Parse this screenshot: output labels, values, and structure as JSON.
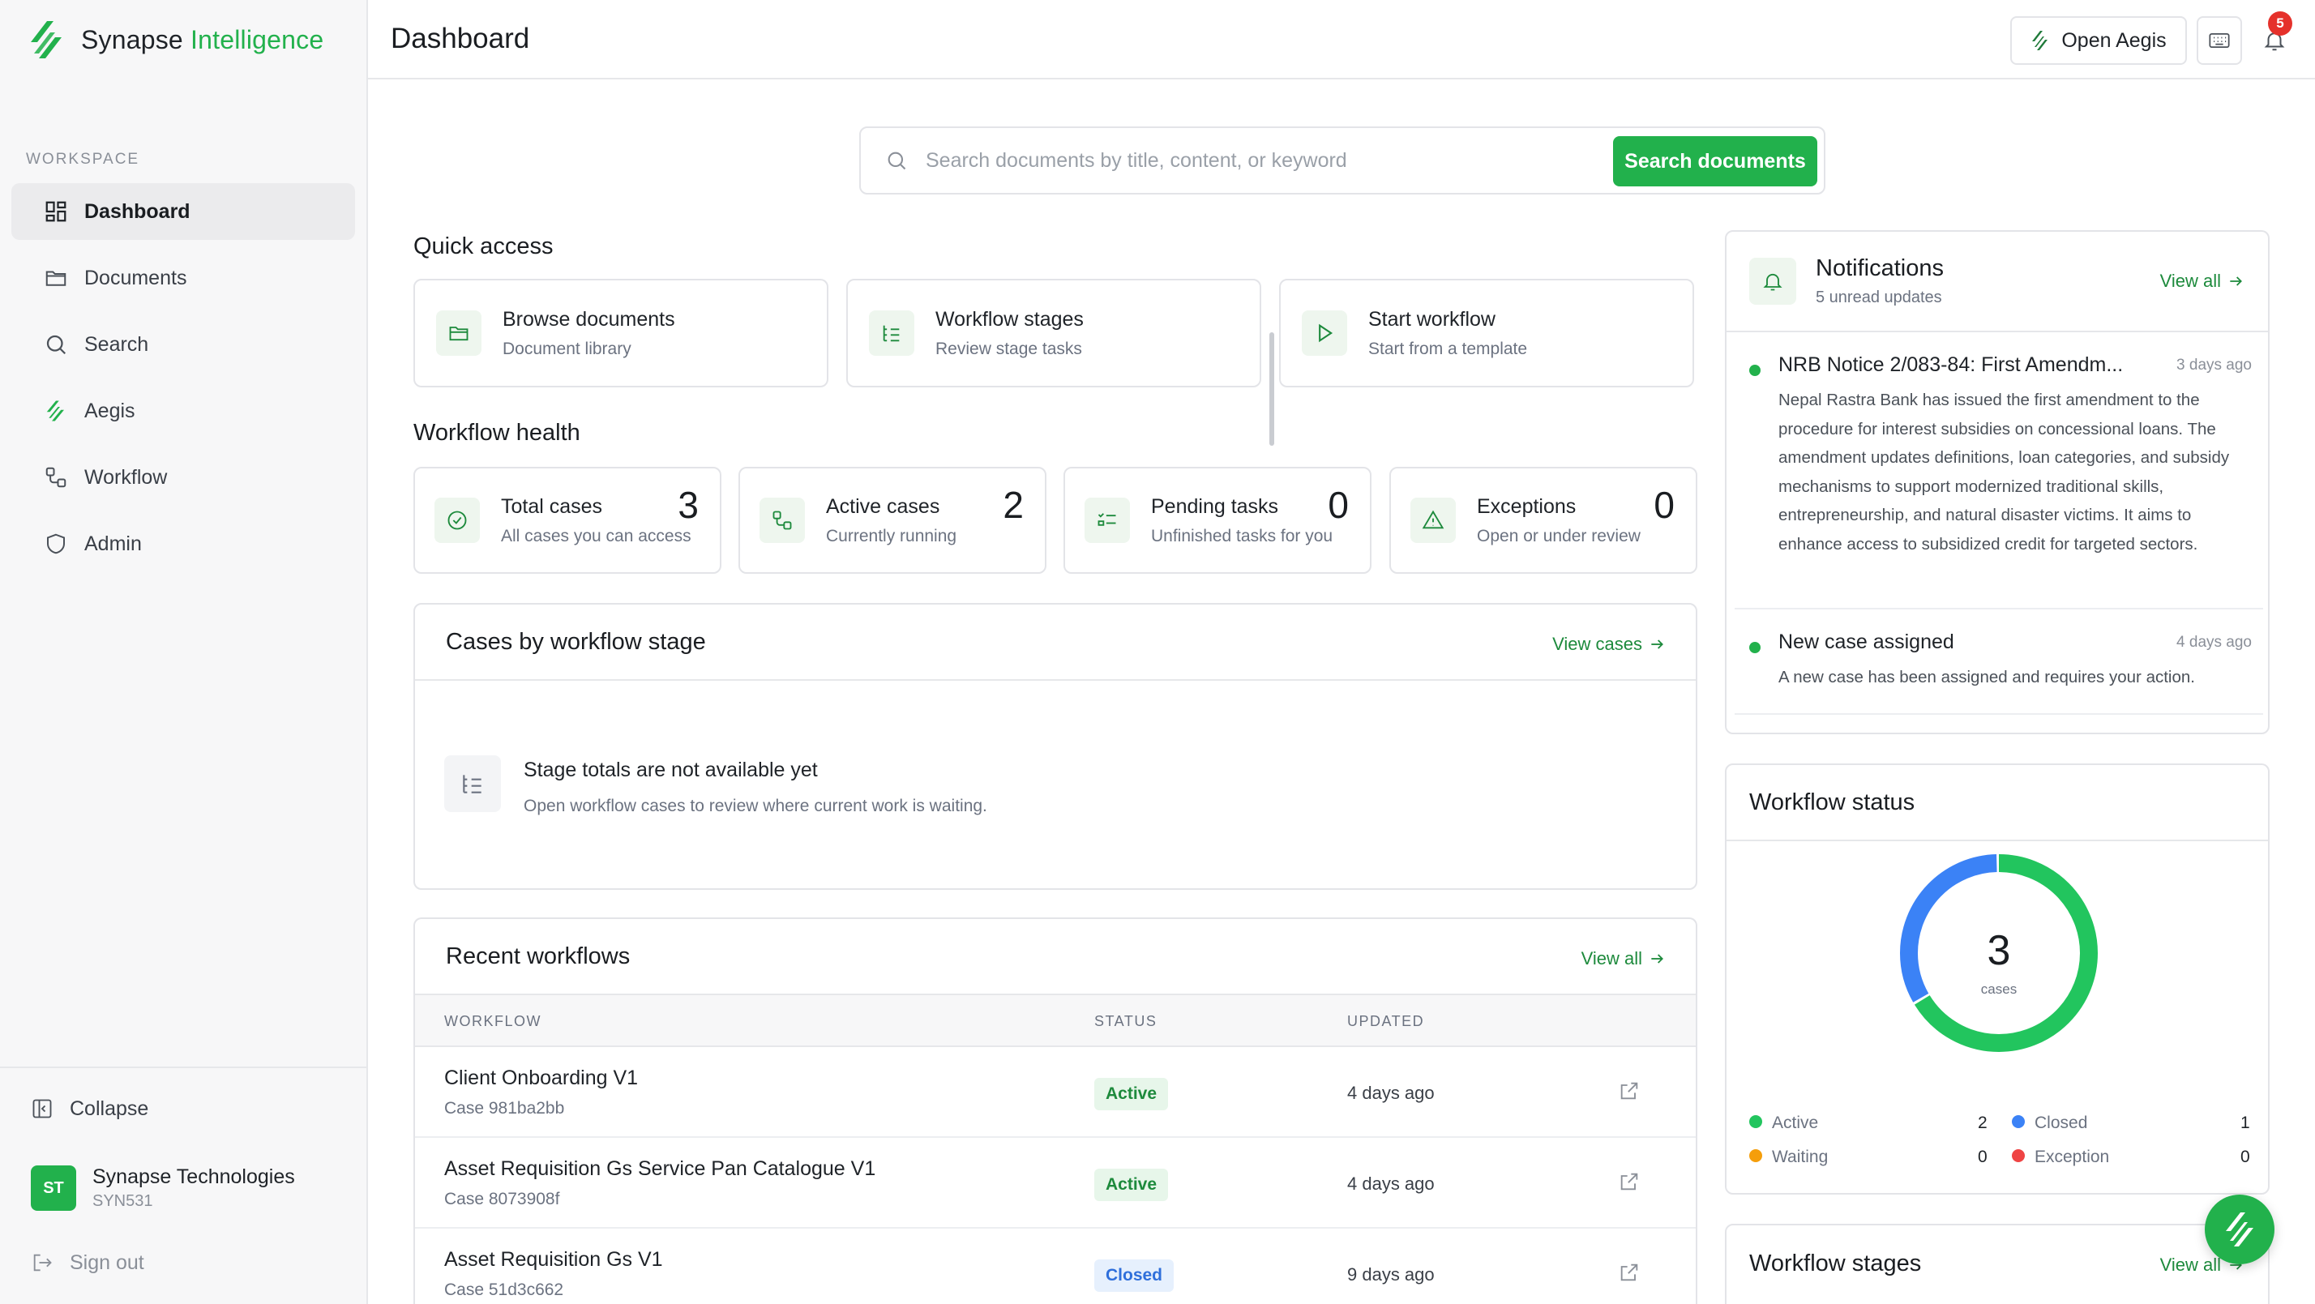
{
  "brand": {
    "name_part1": "Synapse",
    "name_part2": "Intelligence",
    "accent": "#22b14c"
  },
  "sidebar": {
    "section_label": "WORKSPACE",
    "items": [
      {
        "label": "Dashboard",
        "icon": "grid-icon",
        "active": true
      },
      {
        "label": "Documents",
        "icon": "folder-icon"
      },
      {
        "label": "Search",
        "icon": "search-icon"
      },
      {
        "label": "Aegis",
        "icon": "aegis-logo-icon"
      },
      {
        "label": "Workflow",
        "icon": "workflow-icon"
      },
      {
        "label": "Admin",
        "icon": "shield-icon"
      }
    ],
    "collapse_label": "Collapse",
    "org": {
      "initials": "ST",
      "name": "Synapse Technologies",
      "code": "SYN531"
    },
    "signout_label": "Sign out"
  },
  "header": {
    "title": "Dashboard",
    "open_aegis_label": "Open Aegis",
    "notification_count": "5"
  },
  "search": {
    "placeholder": "Search documents by title, content, or keyword",
    "button_label": "Search documents"
  },
  "quick_access": {
    "title": "Quick access",
    "cards": [
      {
        "title": "Browse documents",
        "subtitle": "Document library"
      },
      {
        "title": "Workflow stages",
        "subtitle": "Review stage tasks"
      },
      {
        "title": "Start workflow",
        "subtitle": "Start from a template"
      }
    ]
  },
  "workflow_health": {
    "title": "Workflow health",
    "cards": [
      {
        "title": "Total cases",
        "subtitle": "All cases you can access",
        "count": "3"
      },
      {
        "title": "Active cases",
        "subtitle": "Currently running",
        "count": "2"
      },
      {
        "title": "Pending tasks",
        "subtitle": "Unfinished tasks for you",
        "count": "0"
      },
      {
        "title": "Exceptions",
        "subtitle": "Open or under review",
        "count": "0"
      }
    ]
  },
  "cases_by_stage": {
    "title": "Cases by workflow stage",
    "view_label": "View cases",
    "empty_title": "Stage totals are not available yet",
    "empty_subtitle": "Open workflow cases to review where current work is waiting."
  },
  "recent_workflows": {
    "title": "Recent workflows",
    "view_label": "View all",
    "columns": {
      "workflow": "WORKFLOW",
      "status": "STATUS",
      "updated": "UPDATED"
    },
    "rows": [
      {
        "name": "Client Onboarding V1",
        "case": "Case 981ba2bb",
        "status": "Active",
        "updated": "4 days ago"
      },
      {
        "name": "Asset Requisition Gs Service Pan Catalogue V1",
        "case": "Case 8073908f",
        "status": "Active",
        "updated": "4 days ago"
      },
      {
        "name": "Asset Requisition Gs V1",
        "case": "Case 51d3c662",
        "status": "Closed",
        "updated": "9 days ago"
      }
    ]
  },
  "notifications": {
    "title": "Notifications",
    "subtitle": "5 unread updates",
    "view_label": "View all",
    "items": [
      {
        "title": "NRB Notice 2/083-84: First Amendm...",
        "time": "3 days ago",
        "body": "Nepal Rastra Bank has issued the first amendment to the procedure for interest subsidies on concessional loans. The amendment updates definitions, loan categories, and subsidy mechanisms to support modernized traditional skills, entrepreneurship, and natural disaster victims. It aims to enhance access to subsidized credit for targeted sectors."
      },
      {
        "title": "New case assigned",
        "time": "4 days ago",
        "body": "A new case has been assigned and requires your action."
      }
    ]
  },
  "workflow_status": {
    "title": "Workflow status",
    "total": "3",
    "unit": "cases",
    "legend": [
      {
        "label": "Active",
        "value": 2,
        "color": "#22c55e"
      },
      {
        "label": "Closed",
        "value": 1,
        "color": "#3b82f6"
      },
      {
        "label": "Waiting",
        "value": 0,
        "color": "#f59e0b"
      },
      {
        "label": "Exception",
        "value": 0,
        "color": "#ef4444"
      }
    ]
  },
  "workflow_stages": {
    "title": "Workflow stages",
    "view_label": "View all"
  }
}
